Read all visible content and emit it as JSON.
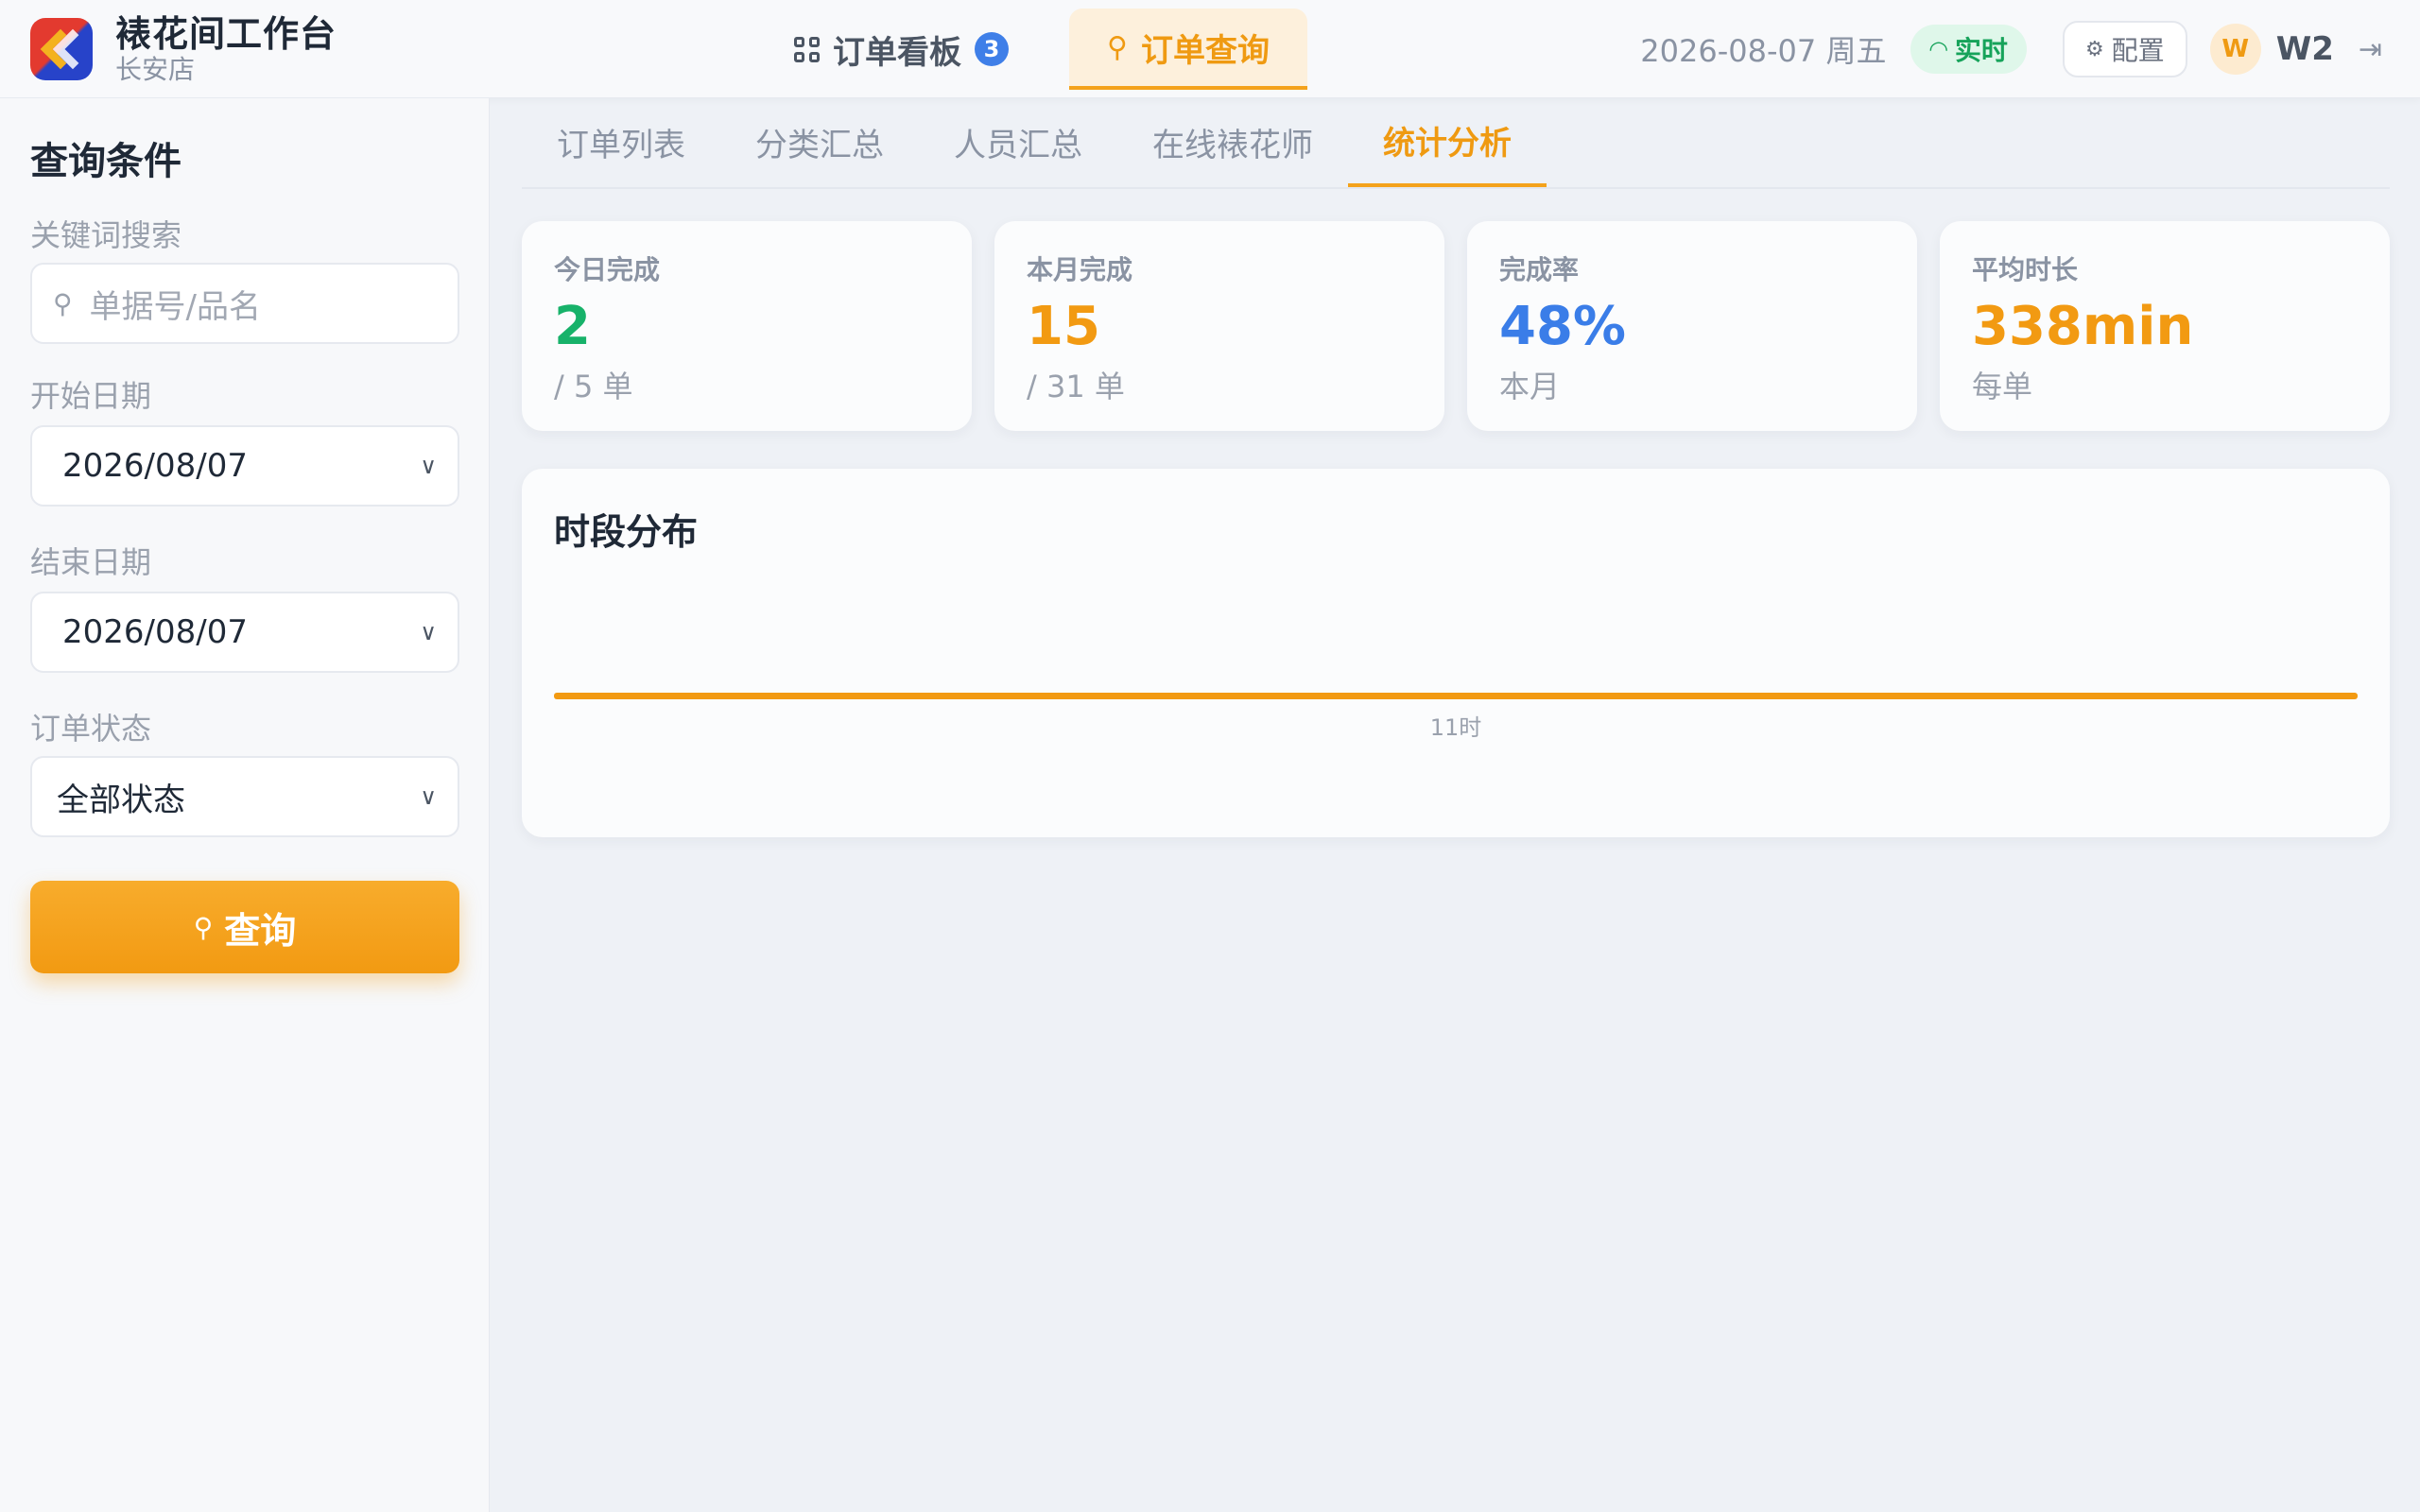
{
  "header": {
    "brand_title": "裱花间工作台",
    "brand_subtitle": "长安店",
    "nav": [
      {
        "label": "订单看板",
        "badge": "3",
        "icon": "grid-icon"
      },
      {
        "label": "订单查询",
        "icon": "search-icon",
        "active": true
      }
    ],
    "datetime": "2026-08-07 周五",
    "live_label": "实时",
    "config_label": "配置",
    "avatar_initial": "W",
    "username": "W2"
  },
  "sidebar": {
    "title": "查询条件",
    "keyword_label": "关键词搜索",
    "keyword_placeholder": "单据号/品名",
    "start_label": "开始日期",
    "start_value": "2026/08/07",
    "end_label": "结束日期",
    "end_value": "2026/08/07",
    "status_label": "订单状态",
    "status_value": "全部状态",
    "query_button": "查询"
  },
  "tabs": [
    {
      "label": "订单列表"
    },
    {
      "label": "分类汇总"
    },
    {
      "label": "人员汇总"
    },
    {
      "label": "在线裱花师"
    },
    {
      "label": "统计分析",
      "active": true
    }
  ],
  "stats": [
    {
      "label": "今日完成",
      "value": "2",
      "sub": "/ 5 单",
      "color": "#17b26a"
    },
    {
      "label": "本月完成",
      "value": "15",
      "sub": "/ 31 单",
      "color": "#f29a12"
    },
    {
      "label": "完成率",
      "value": "48%",
      "sub": "本月",
      "color": "#3a7de8"
    },
    {
      "label": "平均时长",
      "value": "338min",
      "sub": "每单",
      "color": "#f29a12"
    }
  ],
  "chart_card": {
    "title": "时段分布"
  },
  "chart_data": {
    "type": "bar",
    "categories": [
      "11时"
    ],
    "values": [
      1
    ],
    "color": "#f29a12"
  }
}
